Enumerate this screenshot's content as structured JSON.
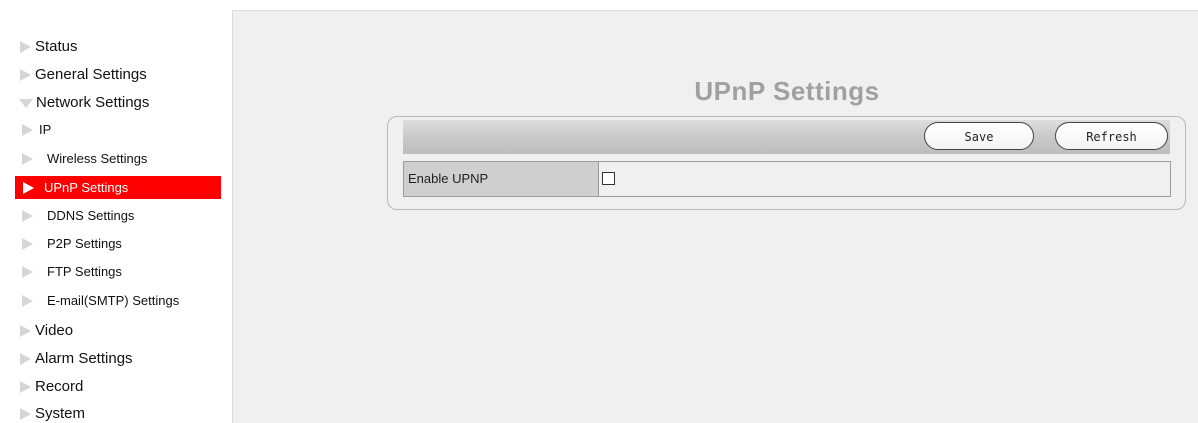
{
  "sidebar": {
    "items": [
      {
        "label": "Status",
        "state": "collapsed"
      },
      {
        "label": "General Settings",
        "state": "collapsed"
      },
      {
        "label": "Network Settings",
        "state": "expanded"
      },
      {
        "label": "IP",
        "state": "sub"
      },
      {
        "label": "Wireless Settings",
        "state": "sub"
      },
      {
        "label": "UPnP Settings",
        "state": "sub-active"
      },
      {
        "label": "DDNS Settings",
        "state": "sub"
      },
      {
        "label": "P2P Settings",
        "state": "sub"
      },
      {
        "label": "FTP Settings",
        "state": "sub"
      },
      {
        "label": "E-mail(SMTP) Settings",
        "state": "sub"
      },
      {
        "label": "Video",
        "state": "collapsed"
      },
      {
        "label": "Alarm Settings",
        "state": "collapsed"
      },
      {
        "label": "Record",
        "state": "collapsed"
      },
      {
        "label": "System",
        "state": "collapsed"
      }
    ],
    "active_color": "#ff0000"
  },
  "main": {
    "title": "UPnP Settings",
    "toolbar": {
      "save_label": "Save",
      "refresh_label": "Refresh"
    },
    "form": {
      "enable_upnp_label": "Enable UPNP",
      "enable_upnp_checked": false
    }
  }
}
